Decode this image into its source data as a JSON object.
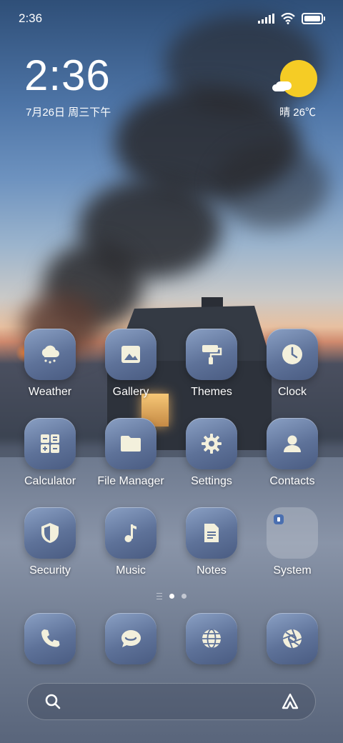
{
  "status_bar": {
    "time": "2:36"
  },
  "clock_widget": {
    "time": "2:36",
    "date": "7月26日 周三下午"
  },
  "weather_widget": {
    "text": "晴 26℃"
  },
  "apps_grid": [
    {
      "label": "Weather",
      "icon": "weather-icon"
    },
    {
      "label": "Gallery",
      "icon": "gallery-icon"
    },
    {
      "label": "Themes",
      "icon": "themes-icon"
    },
    {
      "label": "Clock",
      "icon": "clock-icon"
    },
    {
      "label": "Calculator",
      "icon": "calculator-icon"
    },
    {
      "label": "File Manager",
      "icon": "folder-icon"
    },
    {
      "label": "Settings",
      "icon": "settings-icon"
    },
    {
      "label": "Contacts",
      "icon": "contacts-icon"
    },
    {
      "label": "Security",
      "icon": "shield-icon"
    },
    {
      "label": "Music",
      "icon": "music-icon"
    },
    {
      "label": "Notes",
      "icon": "notes-icon"
    },
    {
      "label": "System",
      "icon": "folder-system-icon"
    }
  ],
  "dock": [
    {
      "icon": "phone-icon"
    },
    {
      "icon": "messages-icon"
    },
    {
      "icon": "browser-icon"
    },
    {
      "icon": "camera-icon"
    }
  ],
  "page_indicator": {
    "current": 1,
    "total": 2
  },
  "colors": {
    "tile_top": "#8aa0c4",
    "tile_bottom": "#4a5c82",
    "sun": "#f5cc25",
    "icon_fill": "#f3f0dc"
  }
}
